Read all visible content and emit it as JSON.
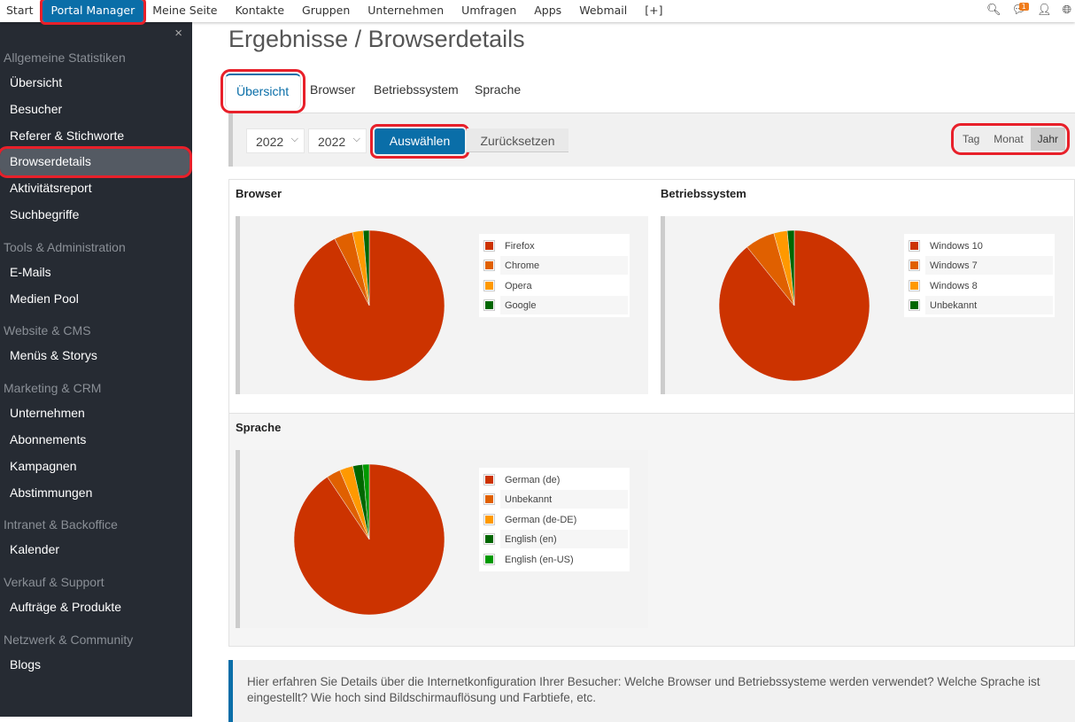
{
  "topbar": {
    "nav": [
      "Start",
      "Portal Manager",
      "Meine Seite",
      "Kontakte",
      "Gruppen",
      "Unternehmen",
      "Umfragen",
      "Apps",
      "Webmail",
      "[+]"
    ],
    "active": "Portal Manager",
    "notification_count": "1",
    "icons": [
      "search-zoom-icon",
      "chat-icon",
      "user-icon",
      "globe-icon"
    ]
  },
  "sidebar": {
    "close": "×",
    "sections": [
      {
        "title": "Allgemeine Statistiken",
        "items": [
          "Übersicht",
          "Besucher",
          "Referer & Stichworte",
          "Browserdetails",
          "Aktivitätsreport",
          "Suchbegriffe"
        ]
      },
      {
        "title": "Tools & Administration",
        "items": [
          "E-Mails",
          "Medien Pool"
        ]
      },
      {
        "title": "Website & CMS",
        "items": [
          "Menüs & Storys"
        ]
      },
      {
        "title": "Marketing & CRM",
        "items": [
          "Unternehmen",
          "Abonnements",
          "Kampagnen",
          "Abstimmungen"
        ]
      },
      {
        "title": "Intranet & Backoffice",
        "items": [
          "Kalender"
        ]
      },
      {
        "title": "Verkauf & Support",
        "items": [
          "Aufträge & Produkte"
        ]
      },
      {
        "title": "Netzwerk & Community",
        "items": [
          "Blogs"
        ]
      }
    ],
    "active": "Browserdetails"
  },
  "page": {
    "title": "Ergebnisse / Browserdetails",
    "tabs": [
      "Übersicht",
      "Browser",
      "Betriebssystem",
      "Sprache"
    ],
    "active_tab": "Übersicht"
  },
  "filter": {
    "year_from": "2022",
    "year_to": "2022",
    "select_label": "Auswählen",
    "reset_label": "Zurücksetzen",
    "periods": [
      "Tag",
      "Monat",
      "Jahr"
    ],
    "active_period": "Jahr"
  },
  "chart_data": [
    {
      "type": "pie",
      "title": "Browser",
      "categories": [
        "Firefox",
        "Chrome",
        "Opera",
        "Google"
      ],
      "values": [
        92.4,
        4.0,
        2.3,
        1.3
      ],
      "colors": [
        "#cc3300",
        "#e06000",
        "#ff9900",
        "#006600"
      ],
      "legend": "right"
    },
    {
      "type": "pie",
      "title": "Betriebssystem",
      "categories": [
        "Windows 10",
        "Windows 7",
        "Windows 8",
        "Unbekannt"
      ],
      "values": [
        89.2,
        6.4,
        2.9,
        1.5
      ],
      "colors": [
        "#cc3300",
        "#e06000",
        "#ff9900",
        "#006600"
      ],
      "legend": "right"
    },
    {
      "type": "pie",
      "title": "Sprache",
      "categories": [
        "German (de)",
        "Unbekannt",
        "German (de-DE)",
        "English (en)",
        "English (en-US)"
      ],
      "values": [
        90.6,
        3.0,
        2.9,
        2.1,
        1.4
      ],
      "colors": [
        "#cc3300",
        "#e06000",
        "#ff9900",
        "#006600",
        "#009900"
      ],
      "legend": "right"
    }
  ],
  "info": "Hier erfahren Sie Details über die Internetkonfiguration Ihrer Besucher: Welche Browser und Betriebssysteme werden verwendet? Welche Sprache ist eingestellt? Wie hoch sind Bildschirmauflösung und Farbtiefe, etc.",
  "colors": {
    "accent": "#0a6ea8",
    "sidebar": "#262b33",
    "highlight": "#e8202a"
  }
}
